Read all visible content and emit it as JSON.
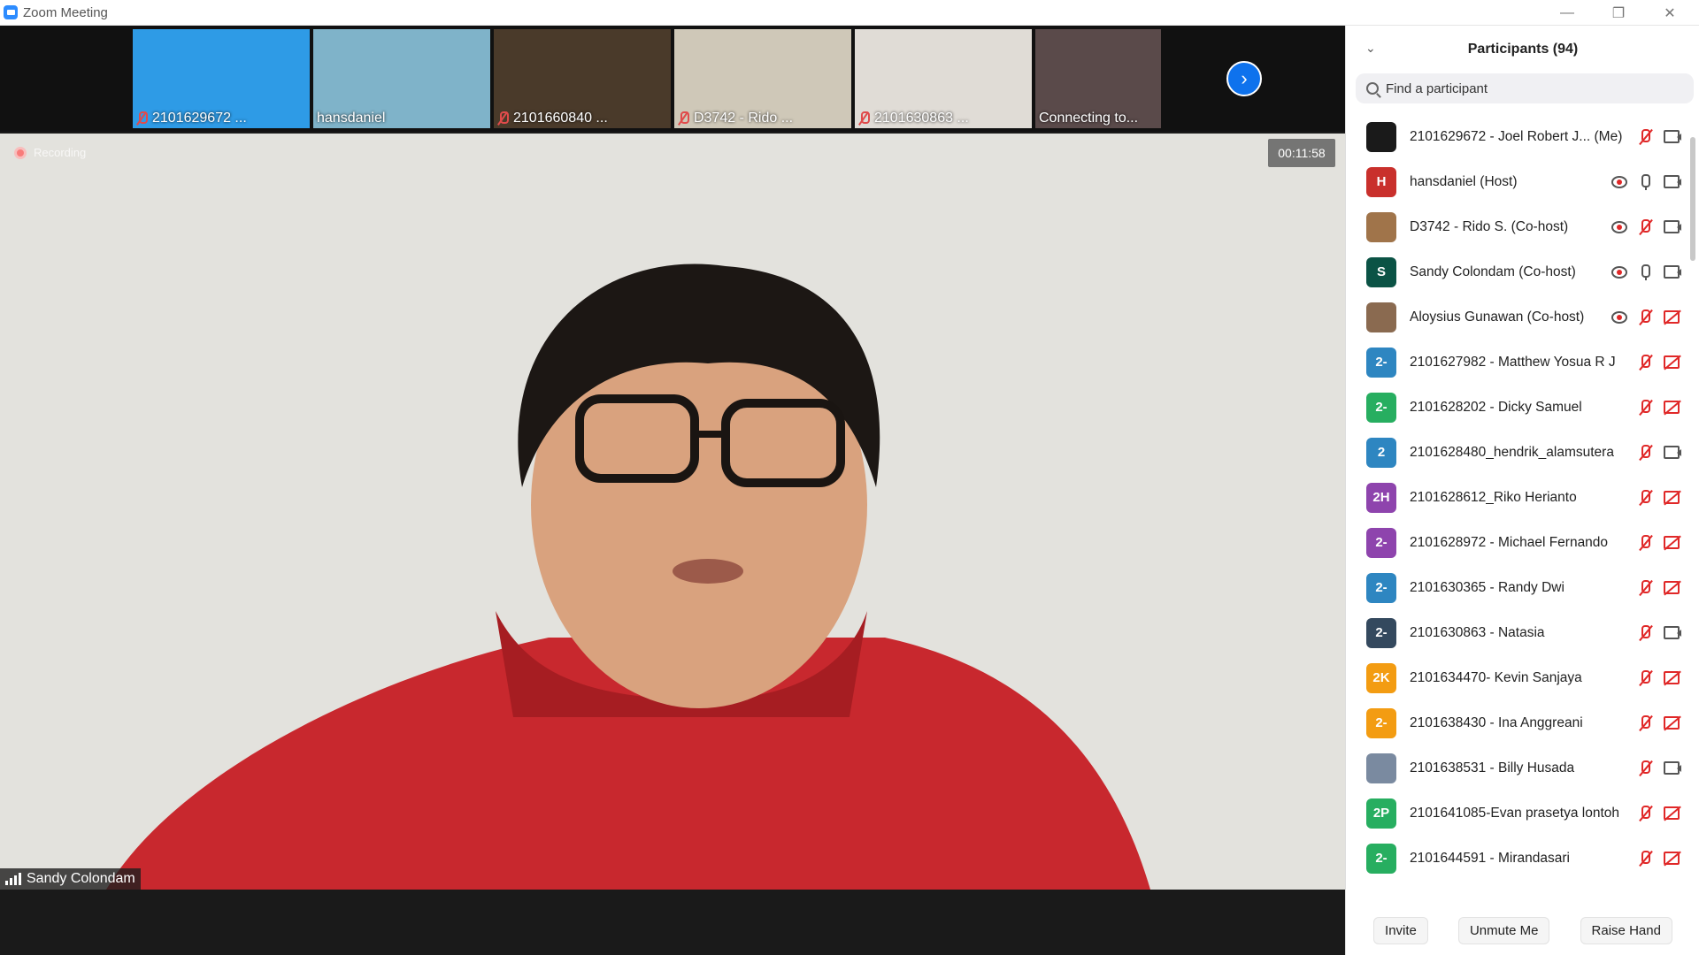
{
  "window": {
    "title": "Zoom Meeting"
  },
  "gallery": [
    {
      "name": "2101629672 ...",
      "muted": true,
      "bg": "#2e9be6"
    },
    {
      "name": "hansdaniel",
      "muted": false,
      "bg": "#7fb3c9"
    },
    {
      "name": "2101660840 ...",
      "muted": true,
      "bg": "#4a3a2a"
    },
    {
      "name": "D3742 - Rido ...",
      "muted": true,
      "bg": "#cfc8b8"
    },
    {
      "name": "2101630863 ...",
      "muted": true,
      "bg": "#e0dcd6"
    },
    {
      "name": "Connecting to...",
      "muted": false,
      "bg": "#5a4a4a"
    }
  ],
  "main_video": {
    "recording_label": "Recording",
    "timer": "00:11:58",
    "speaker": "Sandy Colondam"
  },
  "panel": {
    "title": "Participants (94)",
    "search_placeholder": "Find a participant",
    "participants": [
      {
        "initials": "",
        "color": "#1a1a1a",
        "name": "2101629672 - Joel Robert J...  (Me)",
        "rec": false,
        "mic": "off",
        "cam": "on"
      },
      {
        "initials": "H",
        "color": "#c9302c",
        "name": "hansdaniel (Host)",
        "rec": true,
        "mic": "on",
        "cam": "on"
      },
      {
        "initials": "",
        "color": "#a0744a",
        "name": "D3742 - Rido S. (Co-host)",
        "rec": true,
        "mic": "off",
        "cam": "on"
      },
      {
        "initials": "S",
        "color": "#0b5345",
        "name": "Sandy Colondam (Co-host)",
        "rec": true,
        "mic": "on",
        "cam": "on"
      },
      {
        "initials": "",
        "color": "#8a6a50",
        "name": "Aloysius Gunawan (Co-host)",
        "rec": true,
        "mic": "off",
        "cam": "off"
      },
      {
        "initials": "2-",
        "color": "#2e86c1",
        "name": "2101627982 - Matthew Yosua R J",
        "rec": false,
        "mic": "off",
        "cam": "off"
      },
      {
        "initials": "2-",
        "color": "#27ae60",
        "name": "2101628202 - Dicky Samuel",
        "rec": false,
        "mic": "off",
        "cam": "off"
      },
      {
        "initials": "2",
        "color": "#2e86c1",
        "name": "2101628480_hendrik_alamsutera",
        "rec": false,
        "mic": "off",
        "cam": "on"
      },
      {
        "initials": "2H",
        "color": "#8e44ad",
        "name": "2101628612_Riko Herianto",
        "rec": false,
        "mic": "off",
        "cam": "off"
      },
      {
        "initials": "2-",
        "color": "#8e44ad",
        "name": "2101628972 - Michael Fernando",
        "rec": false,
        "mic": "off",
        "cam": "off"
      },
      {
        "initials": "2-",
        "color": "#2e86c1",
        "name": "2101630365 - Randy Dwi",
        "rec": false,
        "mic": "off",
        "cam": "off"
      },
      {
        "initials": "2-",
        "color": "#34495e",
        "name": "2101630863 - Natasia",
        "rec": false,
        "mic": "off",
        "cam": "on"
      },
      {
        "initials": "2K",
        "color": "#f39c12",
        "name": "2101634470- Kevin Sanjaya",
        "rec": false,
        "mic": "off",
        "cam": "off"
      },
      {
        "initials": "2-",
        "color": "#f39c12",
        "name": "2101638430 - Ina Anggreani",
        "rec": false,
        "mic": "off",
        "cam": "off"
      },
      {
        "initials": "",
        "color": "#7a8aa0",
        "name": "2101638531 - Billy Husada",
        "rec": false,
        "mic": "off",
        "cam": "on"
      },
      {
        "initials": "2P",
        "color": "#27ae60",
        "name": "2101641085-Evan prasetya lontoh",
        "rec": false,
        "mic": "off",
        "cam": "off"
      },
      {
        "initials": "2-",
        "color": "#27ae60",
        "name": "2101644591 - Mirandasari",
        "rec": false,
        "mic": "off",
        "cam": "off"
      }
    ],
    "footer": {
      "invite": "Invite",
      "unmute": "Unmute Me",
      "raise_hand": "Raise Hand"
    }
  }
}
